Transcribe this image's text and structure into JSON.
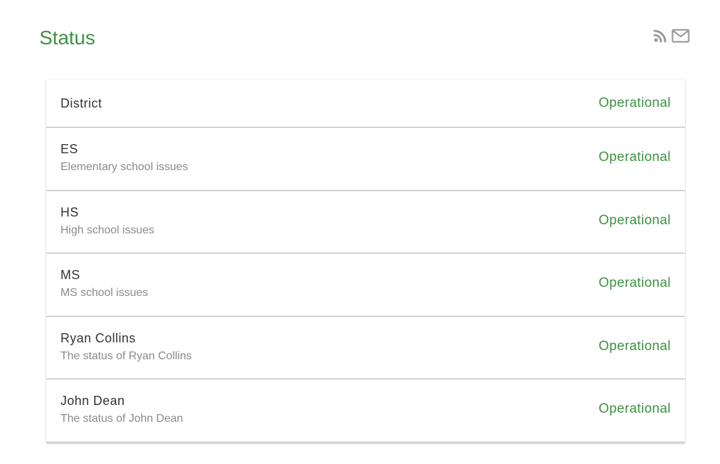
{
  "header": {
    "title": "Status",
    "icons": [
      "rss-icon",
      "mail-icon"
    ]
  },
  "colors": {
    "accent": "#3d9140",
    "name_text": "#333333",
    "desc_text": "#8a8a8a",
    "icon": "#9a9a9a"
  },
  "components": [
    {
      "name": "District",
      "description": "",
      "status": "Operational"
    },
    {
      "name": "ES",
      "description": "Elementary school issues",
      "status": "Operational"
    },
    {
      "name": "HS",
      "description": "High school issues",
      "status": "Operational"
    },
    {
      "name": "MS",
      "description": "MS school issues",
      "status": "Operational"
    },
    {
      "name": "Ryan Collins",
      "description": "The status of Ryan Collins",
      "status": "Operational"
    },
    {
      "name": "John Dean",
      "description": "The status of John Dean",
      "status": "Operational"
    }
  ]
}
